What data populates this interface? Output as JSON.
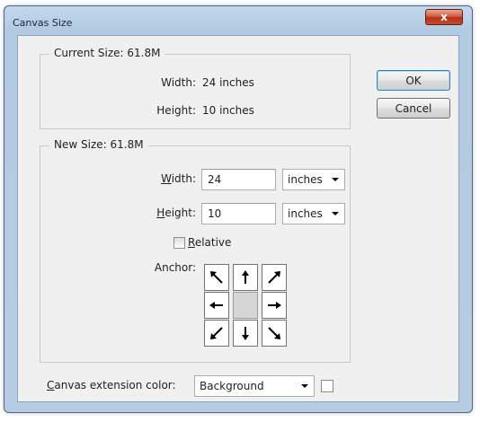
{
  "window": {
    "title": "Canvas Size",
    "close_symbol": "x"
  },
  "current_size": {
    "legend": "Current Size: 61.8M",
    "width_label": "Width:",
    "width_value": "24 inches",
    "height_label": "Height:",
    "height_value": "10 inches"
  },
  "new_size": {
    "legend": "New Size: 61.8M",
    "width": {
      "label_mnemonic": "W",
      "label_rest": "idth:",
      "value": "24",
      "unit": "inches"
    },
    "height": {
      "label_mnemonic": "H",
      "label_rest": "eight:",
      "value": "10",
      "unit": "inches"
    },
    "relative": {
      "label_mnemonic": "R",
      "label_rest": "elative",
      "checked": false
    },
    "anchor": {
      "label": "Anchor:",
      "selected": "center",
      "icons": [
        "arrow-up-left-icon",
        "arrow-up-icon",
        "arrow-up-right-icon",
        "arrow-left-icon",
        "anchor-center",
        "arrow-right-icon",
        "arrow-down-left-icon",
        "arrow-down-icon",
        "arrow-down-right-icon"
      ]
    }
  },
  "buttons": {
    "ok": "OK",
    "cancel": "Cancel"
  },
  "extension": {
    "label_mnemonic": "C",
    "label_rest": "anvas extension color:",
    "value": "Background",
    "swatch_color": "#ffffff"
  }
}
